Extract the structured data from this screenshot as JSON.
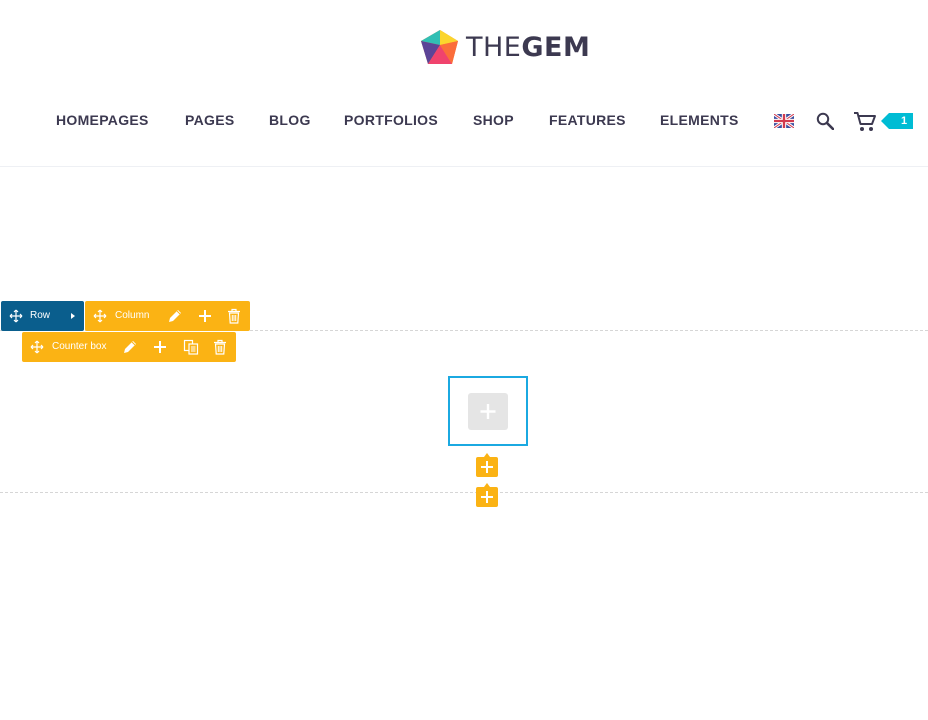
{
  "brand": {
    "logo_text_thin": "THE",
    "logo_text_bold": "GEM",
    "logo_colors": [
      "#fbd52d",
      "#31bfb4",
      "#f0436d",
      "#5c4497",
      "#fb8a3a"
    ]
  },
  "nav": {
    "items": [
      {
        "label": "HOMEPAGES"
      },
      {
        "label": "PAGES"
      },
      {
        "label": "BLOG"
      },
      {
        "label": "PORTFOLIOS"
      },
      {
        "label": "SHOP"
      },
      {
        "label": "FEATURES"
      },
      {
        "label": "ELEMENTS"
      }
    ],
    "language_icon": "uk-flag-icon",
    "search_icon": "search-icon",
    "cart_icon": "cart-icon",
    "cart_count": "1",
    "text_color": "#3c3950",
    "badge_color": "#00bcd4"
  },
  "builder": {
    "row_label": "Row",
    "column_label": "Column",
    "counter_box_label": "Counter box",
    "row_color": "#0a5e8d",
    "element_color": "#fbb314",
    "focus_color": "#1ba9e1"
  }
}
